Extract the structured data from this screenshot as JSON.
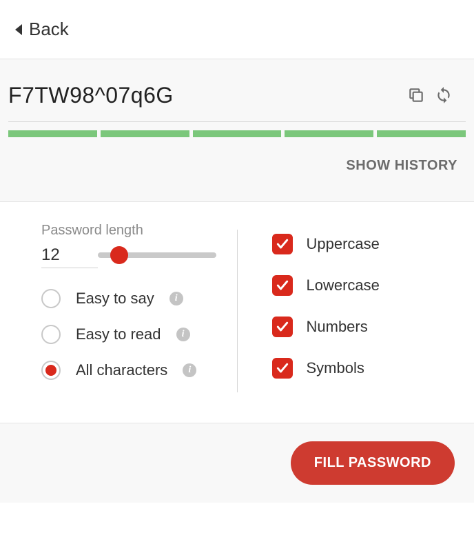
{
  "back_label": "Back",
  "password": "F7TW98^07q6G",
  "strength_segments": 5,
  "show_history_label": "SHOW HISTORY",
  "length": {
    "label": "Password length",
    "value": "12",
    "slider_percent": 18
  },
  "modes": [
    {
      "label": "Easy to say",
      "checked": false
    },
    {
      "label": "Easy to read",
      "checked": false
    },
    {
      "label": "All characters",
      "checked": true
    }
  ],
  "char_options": [
    {
      "label": "Uppercase",
      "checked": true
    },
    {
      "label": "Lowercase",
      "checked": true
    },
    {
      "label": "Numbers",
      "checked": true
    },
    {
      "label": "Symbols",
      "checked": true
    }
  ],
  "fill_label": "FILL PASSWORD",
  "colors": {
    "accent": "#d9291c",
    "strength": "#7bc77b"
  }
}
